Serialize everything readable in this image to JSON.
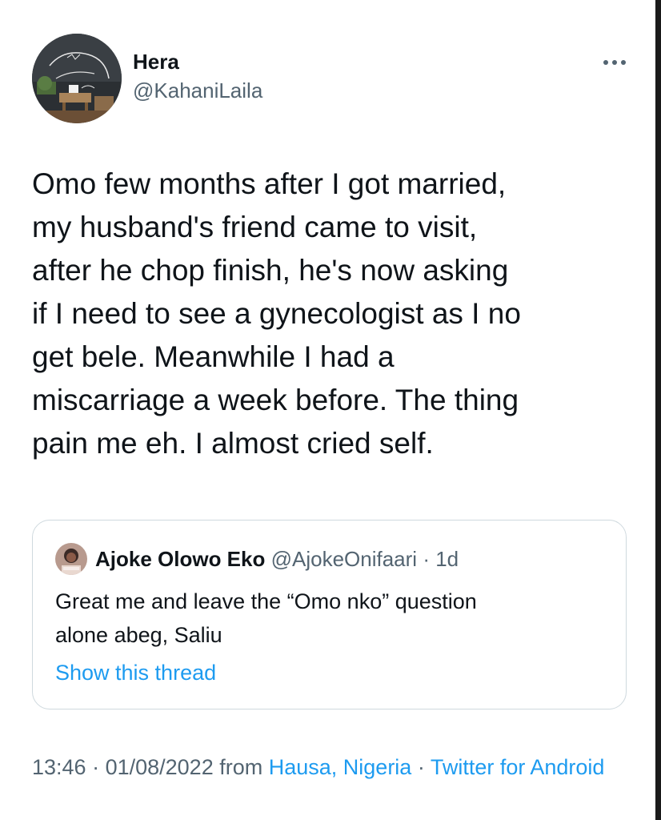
{
  "author": {
    "display_name": "Hera",
    "handle": "@KahaniLaila"
  },
  "more_icon": "ellipsis-icon",
  "tweet": {
    "text": "Omo few months after I got married,\nmy husband's friend came to visit,\nafter he chop finish, he's now asking\nif I need to see a gynecologist as I no\nget bele. Meanwhile I had a\nmiscarriage a week before. The thing\npain me eh. I almost cried self."
  },
  "quoted_tweet": {
    "display_name": "Ajoke Olowo Eko",
    "handle": "@AjokeOnifaari",
    "separator": " · ",
    "age": "1d",
    "text": "Great me and leave the “Omo nko” question\nalone abeg, Saliu",
    "show_thread_label": "Show this thread"
  },
  "meta": {
    "time": "13:46",
    "separator": " · ",
    "date": "01/08/2022",
    "from_label": " from ",
    "location": "Hausa, Nigeria",
    "client": "Twitter for Android"
  },
  "colors": {
    "text_primary": "#0f1419",
    "text_secondary": "#536471",
    "link": "#1d9bf0",
    "border": "#cfd9de"
  }
}
